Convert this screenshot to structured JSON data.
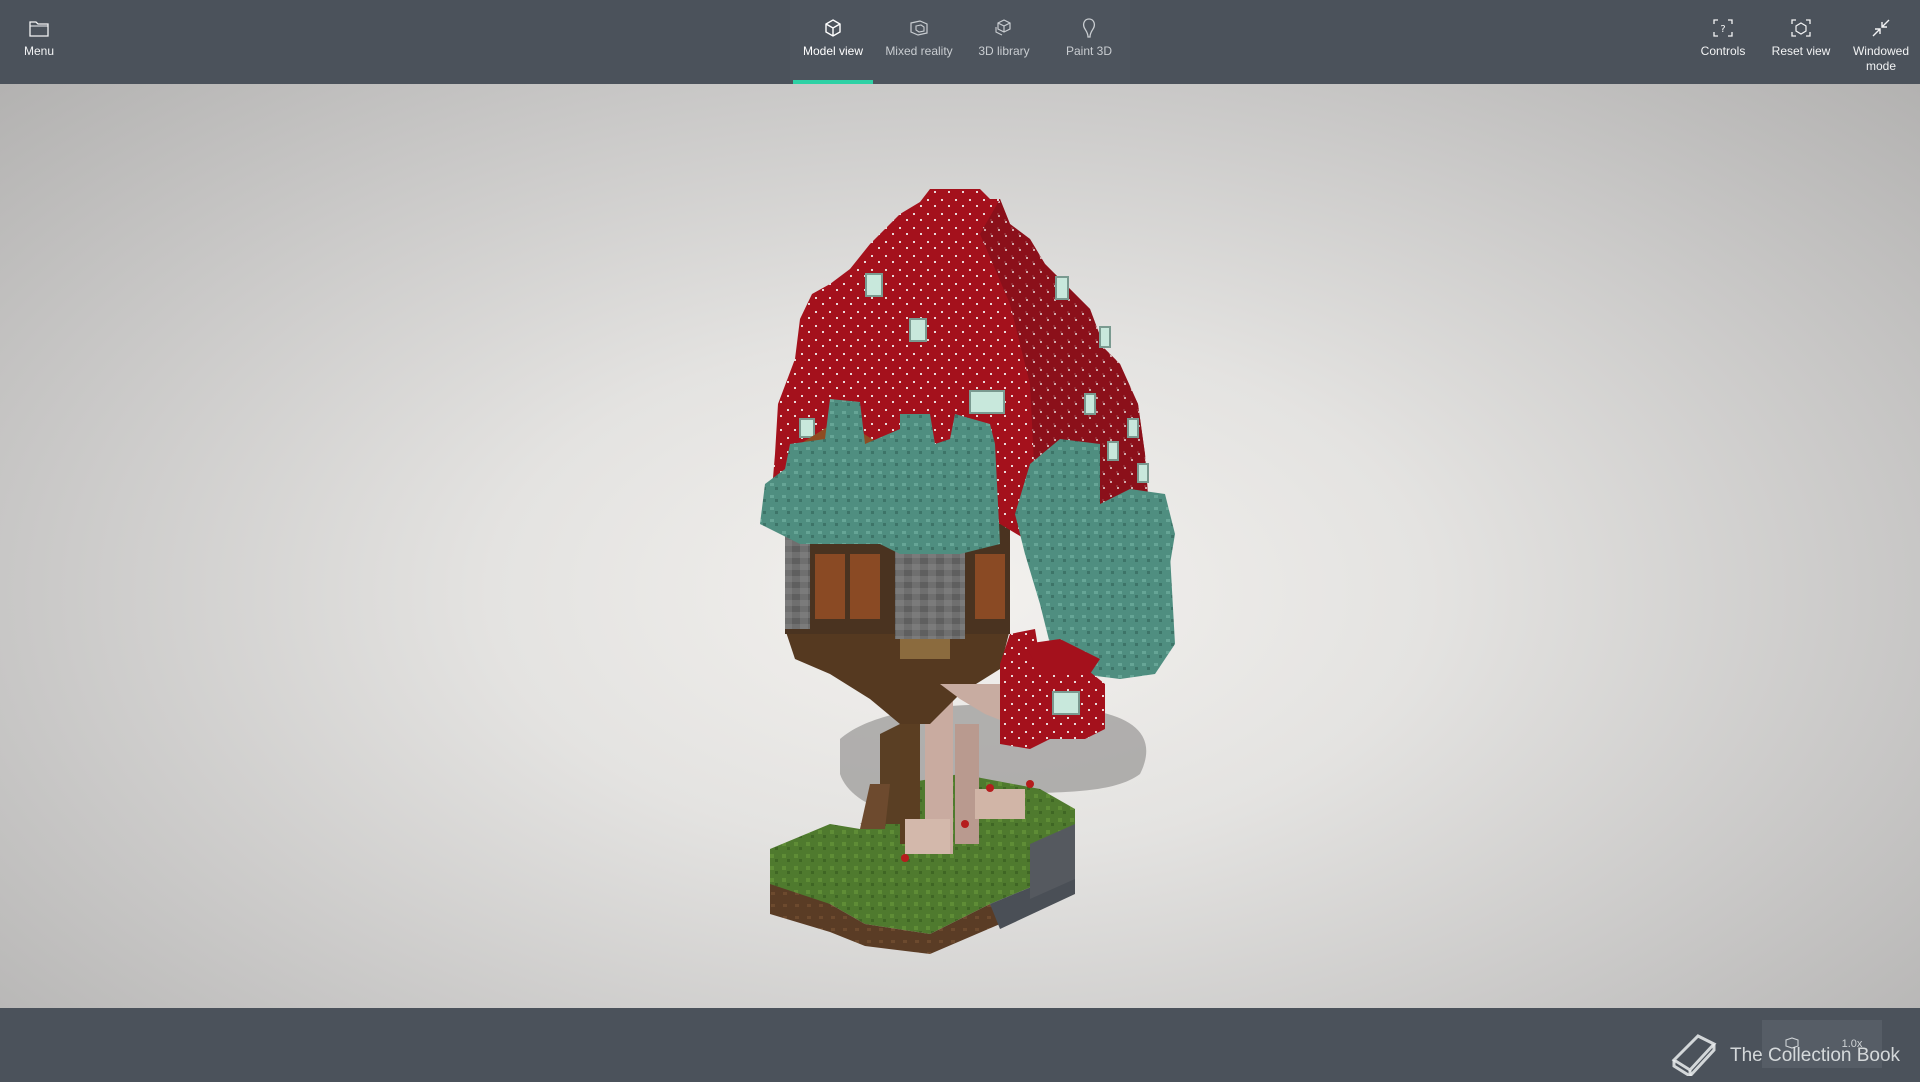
{
  "toolbar": {
    "menu_label": "Menu",
    "tabs": [
      {
        "label": "Model view",
        "icon": "cube-icon",
        "active": true
      },
      {
        "label": "Mixed reality",
        "icon": "mixed-reality-icon",
        "active": false
      },
      {
        "label": "3D library",
        "icon": "3d-library-icon",
        "active": false
      },
      {
        "label": "Paint 3D",
        "icon": "paint-3d-icon",
        "active": false
      }
    ],
    "right": [
      {
        "label": "Controls",
        "icon": "controls-icon"
      },
      {
        "label": "Reset view",
        "icon": "reset-view-icon"
      },
      {
        "label": "Windowed\nmode",
        "icon": "windowed-mode-icon"
      }
    ]
  },
  "viewport": {
    "zoom": "1.0x"
  },
  "watermark": {
    "text": "The Collection Book"
  },
  "colors": {
    "accent": "#2ed1a5",
    "bar": "#4b525b",
    "cap": "#a4111c",
    "foliage": "#4f8e80"
  }
}
